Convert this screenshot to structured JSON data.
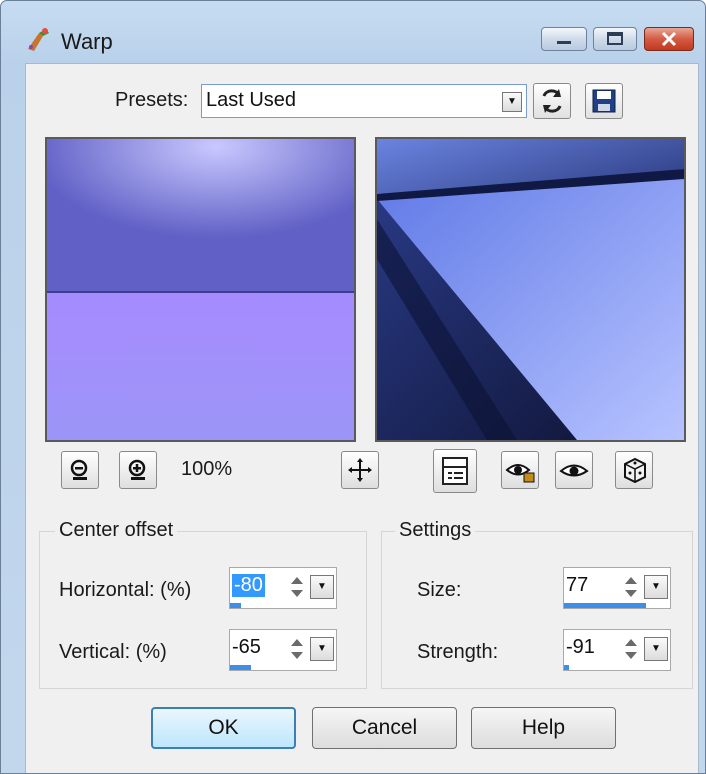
{
  "window": {
    "title": "Warp"
  },
  "presets": {
    "label": "Presets:",
    "value": "Last Used"
  },
  "zoom": {
    "level": "100%"
  },
  "center_offset": {
    "title": "Center offset",
    "horizontal": {
      "label": "Horizontal: (%)",
      "value": "-80",
      "meter": 0.1
    },
    "vertical": {
      "label": "Vertical: (%)",
      "value": "-65",
      "meter": 0.2
    }
  },
  "settings": {
    "title": "Settings",
    "size": {
      "label": "Size:",
      "value": "77",
      "meter": 0.77
    },
    "strength": {
      "label": "Strength:",
      "value": "-91",
      "meter": 0.05
    }
  },
  "buttons": {
    "ok": "OK",
    "cancel": "Cancel",
    "help": "Help"
  },
  "colors": {
    "accent": "#3d8ee8",
    "selection": "#3399ff",
    "close": "#c2391f"
  },
  "icons": [
    "warp-app-icon",
    "minimize-icon",
    "maximize-icon",
    "close-icon",
    "combo-arrow-icon",
    "reset-icon",
    "save-icon",
    "zoom-out-icon",
    "zoom-in-icon",
    "move-icon",
    "proof-icon",
    "lock-preview-icon",
    "preview-icon",
    "randomize-icon",
    "spin-icon",
    "dropdown-icon"
  ]
}
